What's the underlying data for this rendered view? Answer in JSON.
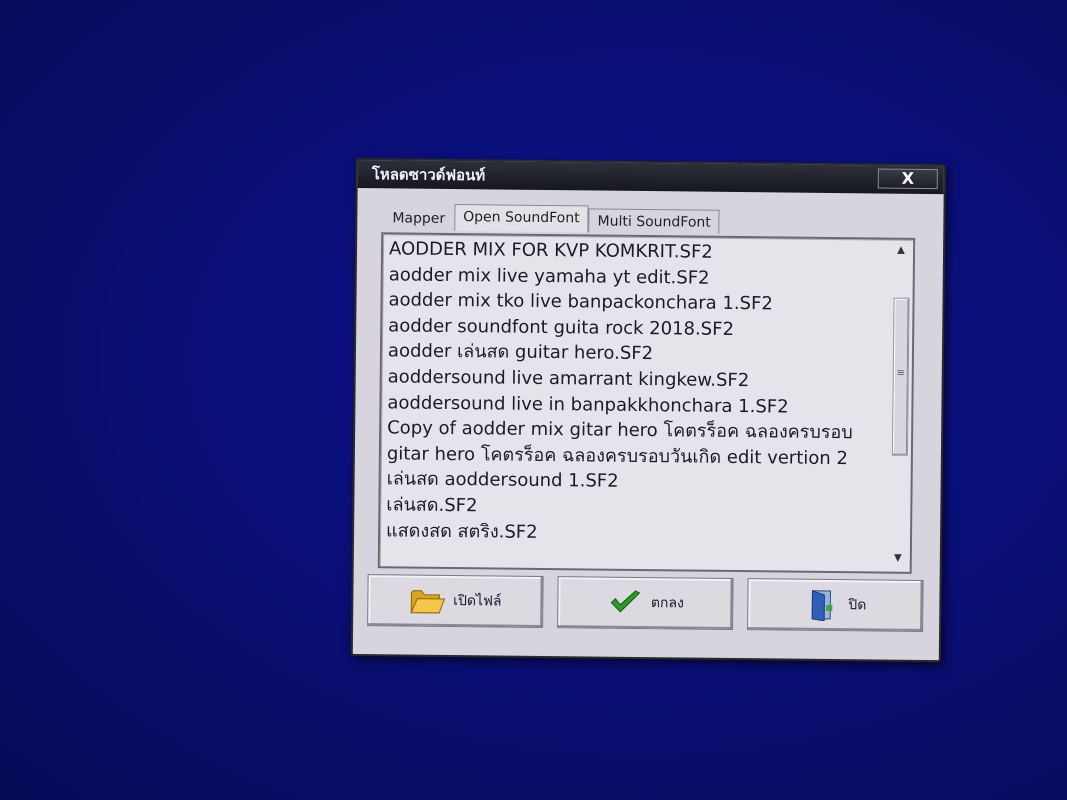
{
  "dialog": {
    "title": "โหลดซาวด์ฟอนท์",
    "close_label": "X"
  },
  "tabs": [
    {
      "label": "Mapper"
    },
    {
      "label": "Open SoundFont"
    },
    {
      "label": "Multi SoundFont"
    }
  ],
  "list": {
    "items": [
      "AODDER MIX FOR KVP KOMKRIT.SF2",
      "aodder mix live yamaha yt edit.SF2",
      "aodder mix tko live banpackonchara 1.SF2",
      "aodder soundfont guita rock 2018.SF2",
      "aodder เล่นสด guitar hero.SF2",
      "aoddersound live amarrant kingkew.SF2",
      "aoddersound live in banpakkhonchara 1.SF2",
      "Copy of aodder mix gitar hero โคตรร็อค ฉลองครบรอบ",
      "gitar hero โคตรร็อค ฉลองครบรอบวันเกิด edit vertion 2",
      "เล่นสด aoddersound 1.SF2",
      "เล่นสด.SF2",
      "แสดงสด สตริง.SF2"
    ]
  },
  "buttons": {
    "open_label": "เปิดไฟล์",
    "ok_label": "ตกลง",
    "close_label": "ปิด"
  },
  "icons": {
    "folder": "folder-icon",
    "ok": "checkmark-icon",
    "exit": "exit-door-icon"
  },
  "colors": {
    "desktop": "#0a0f78",
    "dialog_bg": "#d8d4de",
    "titlebar": "#1e1f28",
    "check": "#2e9a2a",
    "folder": "#e8b830"
  }
}
